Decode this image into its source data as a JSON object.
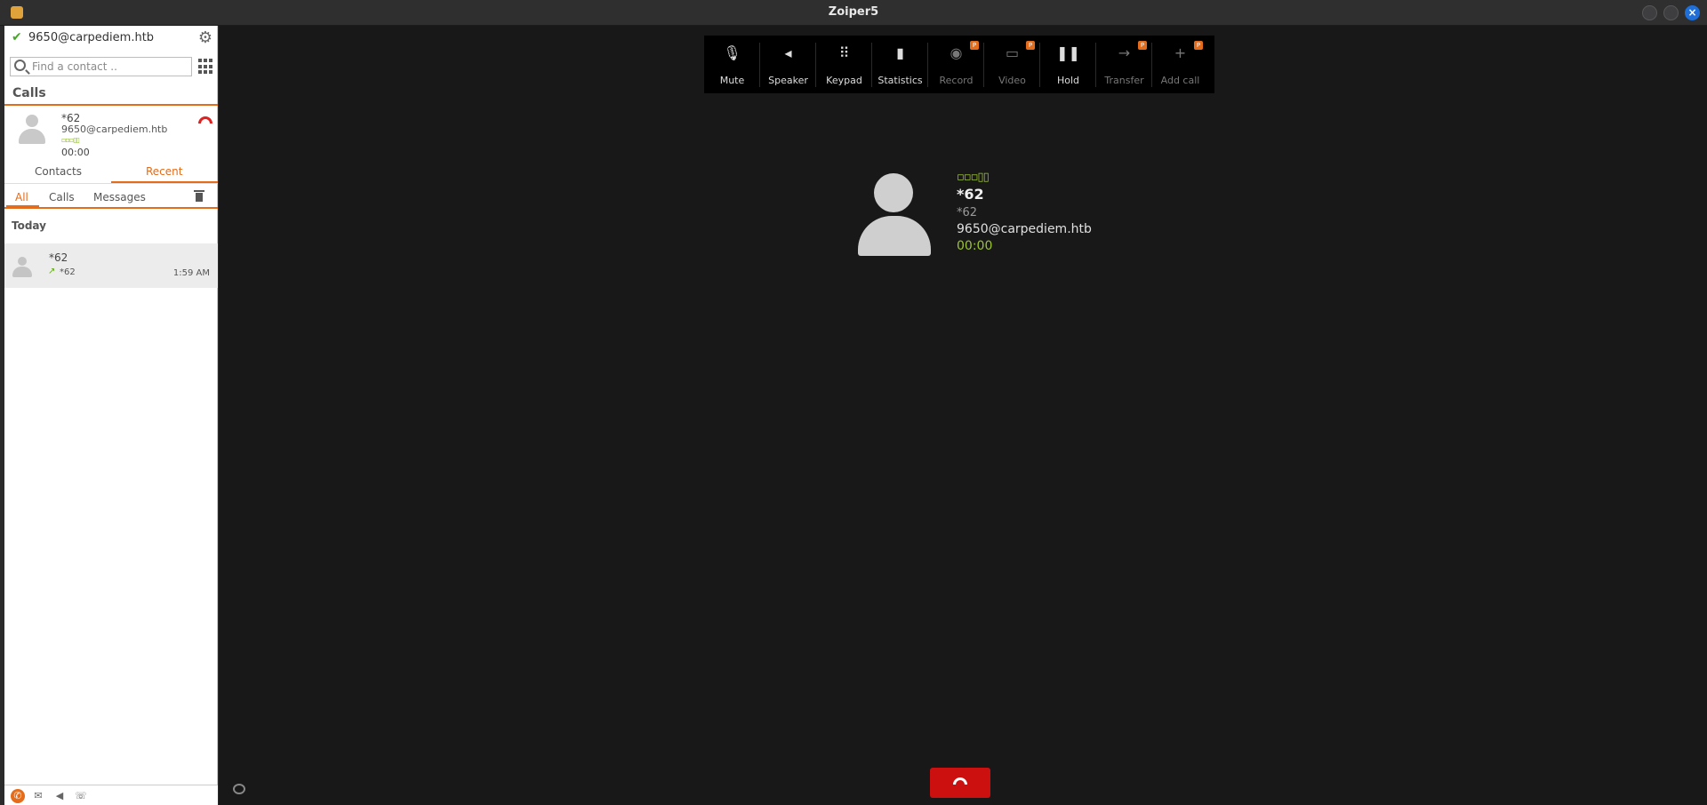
{
  "window": {
    "title": "Zoiper5"
  },
  "account": {
    "name": "9650@carpediem.htb"
  },
  "search": {
    "placeholder": "Find a contact .."
  },
  "calls": {
    "header": "Calls",
    "active": {
      "number": "*62",
      "uri": "9650@carpediem.htb",
      "signal": "▫▫▫▯▯",
      "time": "00:00"
    }
  },
  "tabs": {
    "contacts": "Contacts",
    "recent": "Recent"
  },
  "subtabs": {
    "all": "All",
    "calls": "Calls",
    "messages": "Messages"
  },
  "recent": {
    "group": "Today",
    "items": [
      {
        "name": "*62",
        "sub": "*62",
        "time": "1:59 AM"
      }
    ]
  },
  "toolbar": {
    "mute": "Mute",
    "speaker": "Speaker",
    "keypad": "Keypad",
    "statistics": "Statistics",
    "record": "Record",
    "video": "Video",
    "hold": "Hold",
    "transfer": "Transfer",
    "add_call": "Add call",
    "pro_badge": "P"
  },
  "call": {
    "signal": "▫▫▫▯▯",
    "name": "*62",
    "number": "*62",
    "uri": "9650@carpediem.htb",
    "timer": "00:00"
  },
  "colors": {
    "accent": "#e46c1b",
    "hangup": "#cc1010",
    "signal": "#9bc52f"
  }
}
